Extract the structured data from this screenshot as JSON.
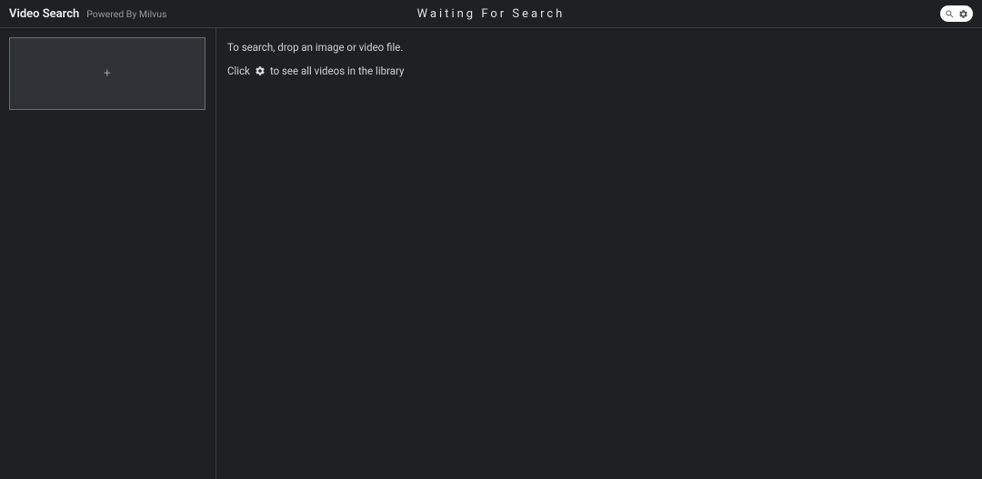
{
  "header": {
    "title": "Video Search",
    "subtitle": "Powered By Milvus",
    "status": "Waiting For Search",
    "icons": {
      "search": "search-icon",
      "settings": "gear-icon"
    }
  },
  "sidebar": {
    "dropzone": {
      "plus_symbol": "+"
    }
  },
  "content": {
    "hint1": "To search, drop an image or video file.",
    "hint2_prefix": "Click",
    "hint2_suffix": "to see all videos in the library"
  }
}
